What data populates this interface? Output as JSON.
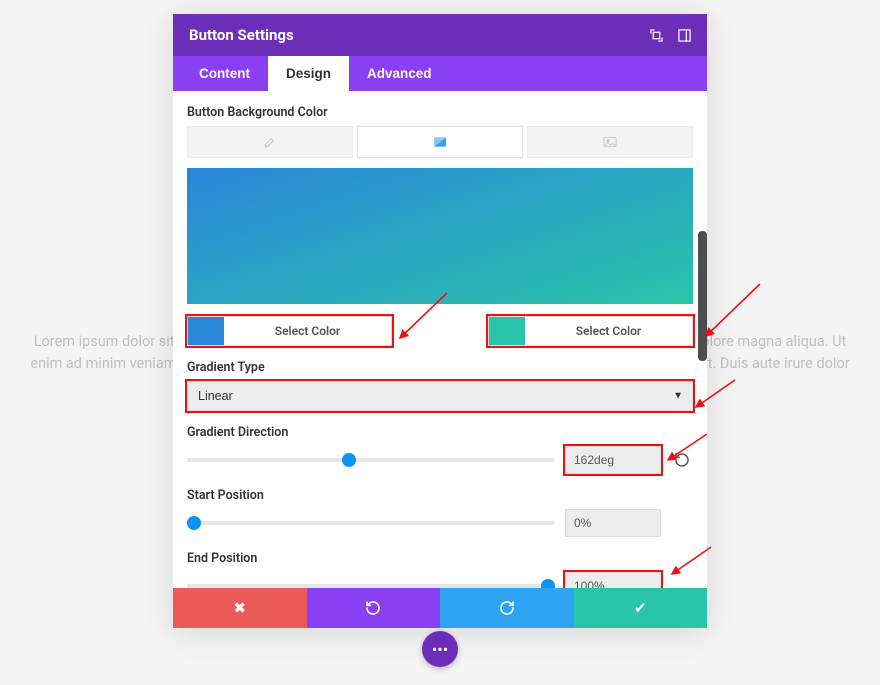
{
  "background_text": "Lorem ipsum dolor sit amet, consectetur adipiscing elit, sed do eiusmod tempor incididunt ut labore et dolore magna aliqua. Ut enim ad minim veniam, quis nostrud exercitation ullamco laboris nisi ut aliquip ex ea commodo consequat. Duis aute irure dolor",
  "header": {
    "title": "Button Settings"
  },
  "tabs": {
    "content": "Content",
    "design": "Design",
    "advanced": "Advanced"
  },
  "section": {
    "bg_label": "Button Background Color",
    "select_color": "Select Color",
    "gradient_type_label": "Gradient Type",
    "gradient_type_value": "Linear",
    "gradient_direction_label": "Gradient Direction",
    "gradient_direction_value": "162deg",
    "start_position_label": "Start Position",
    "start_position_value": "0%",
    "end_position_label": "End Position",
    "end_position_value": "100%"
  },
  "colors": {
    "start": "#2b87da",
    "end": "#29c4a9"
  }
}
